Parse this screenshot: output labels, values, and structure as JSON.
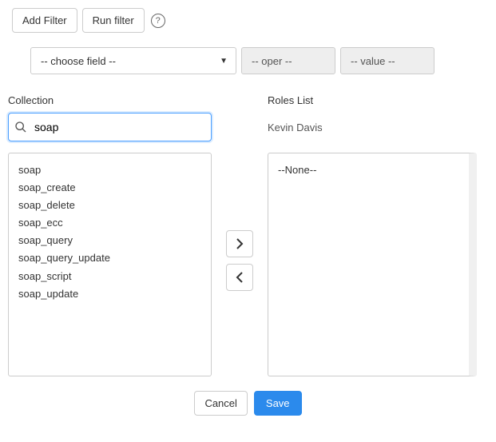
{
  "toolbar": {
    "add_filter": "Add Filter",
    "run_filter": "Run filter",
    "help": "?"
  },
  "filter": {
    "field_placeholder": "-- choose field --",
    "oper_placeholder": "-- oper --",
    "value_placeholder": "-- value --"
  },
  "collection": {
    "label": "Collection",
    "search_value": "soap",
    "items": {
      "0": "soap",
      "1": "soap_create",
      "2": "soap_delete",
      "3": "soap_ecc",
      "4": "soap_query",
      "5": "soap_query_update",
      "6": "soap_script",
      "7": "soap_update"
    }
  },
  "roles": {
    "label": "Roles List",
    "user": "Kevin Davis",
    "none": "--None--"
  },
  "footer": {
    "cancel": "Cancel",
    "save": "Save"
  }
}
